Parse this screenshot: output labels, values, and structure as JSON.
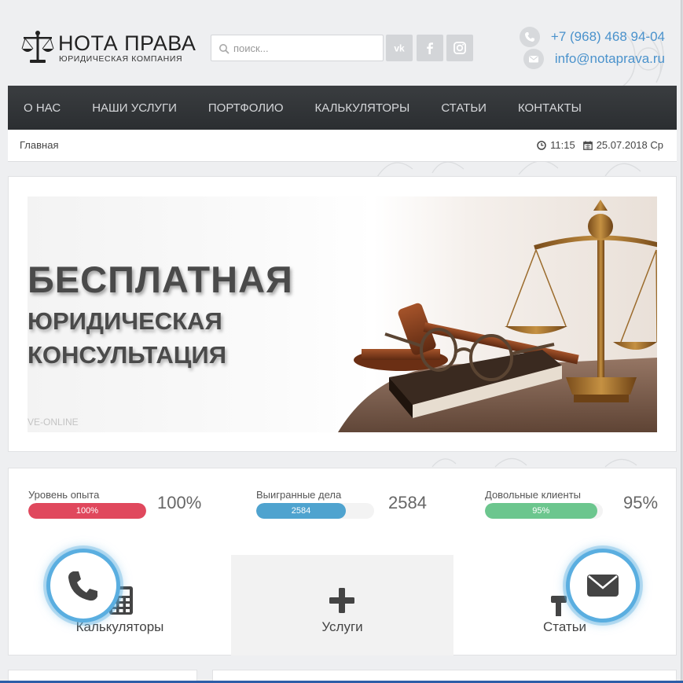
{
  "header": {
    "logo_title": "НОТА ПРАВА",
    "logo_subtitle": "ЮРИДИЧЕСКАЯ КОМПАНИЯ",
    "search_placeholder": "поиск...",
    "phone": "+7 (968) 468 94-04",
    "email": "info@notaprava.ru",
    "social_icons": [
      "vk-icon",
      "facebook-icon",
      "instagram-icon"
    ]
  },
  "nav": {
    "items": [
      "О НАС",
      "НАШИ УСЛУГИ",
      "ПОРТФОЛИО",
      "КАЛЬКУЛЯТОРЫ",
      "СТАТЬИ",
      "КОНТАКТЫ"
    ]
  },
  "breadcrumb": {
    "current": "Главная",
    "time": "11:15",
    "date": "25.07.2018 Ср"
  },
  "banner": {
    "line1": "БЕСПЛАТНАЯ",
    "line2": "ЮРИДИЧЕСКАЯ",
    "line3": "КОНСУЛЬТАЦИЯ",
    "watermark": "VE-ONLINE"
  },
  "stats": [
    {
      "label": "Уровень опыта",
      "bar_text": "100%",
      "value": "100%",
      "fill_percent": 100,
      "color": "#e0485d"
    },
    {
      "label": "Выигранные дела",
      "bar_text": "2584",
      "value": "2584",
      "fill_percent": 76,
      "color": "#4fa3cf"
    },
    {
      "label": "Довольные клиенты",
      "bar_text": "95%",
      "value": "95%",
      "fill_percent": 95,
      "color": "#6cc68e"
    }
  ],
  "tiles": [
    {
      "label": "Калькуляторы",
      "icon": "calculator-icon"
    },
    {
      "label": "Услуги",
      "icon": "plus-icon"
    },
    {
      "label": "Статьи",
      "icon": "gavel-icon"
    }
  ],
  "floating_buttons": [
    "phone-icon",
    "envelope-icon"
  ],
  "colors": {
    "accent": "#4a92cc",
    "nav_bg": "#2f3235",
    "fab_ring": "#5aaee0"
  }
}
